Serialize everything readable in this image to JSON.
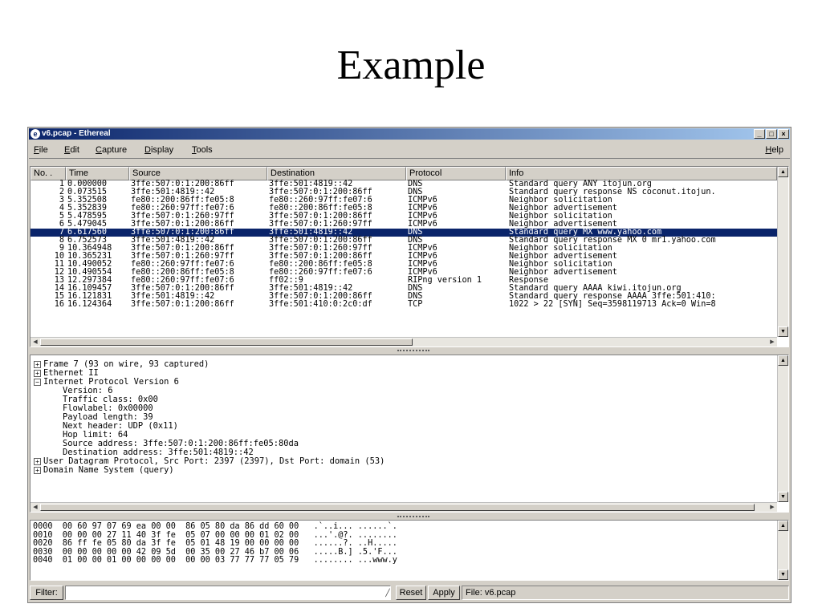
{
  "slide": {
    "title": "Example"
  },
  "window": {
    "title": "v6.pcap - Ethereal",
    "buttons": {
      "minimize": "_",
      "maximize": "□",
      "close": "×"
    }
  },
  "menu": {
    "file": "File",
    "edit": "Edit",
    "capture": "Capture",
    "display": "Display",
    "tools": "Tools",
    "help": "Help"
  },
  "packet_list": {
    "columns": [
      "No. .",
      "Time",
      "Source",
      "Destination",
      "Protocol",
      "Info"
    ],
    "selected_index": 6,
    "rows": [
      [
        "1",
        "0.000000",
        "3ffe:507:0:1:200:86ff",
        "3ffe:501:4819::42",
        "DNS",
        "Standard query ANY itojun.org"
      ],
      [
        "2",
        "0.073515",
        "3ffe:501:4819::42",
        "3ffe:507:0:1:200:86ff",
        "DNS",
        "Standard query response NS coconut.itojun."
      ],
      [
        "3",
        "5.352508",
        "fe80::200:86ff:fe05:8",
        "fe80::260:97ff:fe07:6",
        "ICMPv6",
        "Neighbor solicitation"
      ],
      [
        "4",
        "5.352839",
        "fe80::260:97ff:fe07:6",
        "fe80::200:86ff:fe05:8",
        "ICMPv6",
        "Neighbor advertisement"
      ],
      [
        "5",
        "5.478595",
        "3ffe:507:0:1:260:97ff",
        "3ffe:507:0:1:200:86ff",
        "ICMPv6",
        "Neighbor solicitation"
      ],
      [
        "6",
        "5.479045",
        "3ffe:507:0:1:200:86ff",
        "3ffe:507:0:1:260:97ff",
        "ICMPv6",
        "Neighbor advertisement"
      ],
      [
        "7",
        "6.617560",
        "3ffe:507:0:1:200:86ff",
        "3ffe:501:4819::42",
        "DNS",
        "Standard query MX www.yahoo.com"
      ],
      [
        "8",
        "6.752573",
        "3ffe:501:4819::42",
        "3ffe:507:0:1:200:86ff",
        "DNS",
        "Standard query response MX 0 mr1.yahoo.com"
      ],
      [
        "9",
        "10.364948",
        "3ffe:507:0:1:200:86ff",
        "3ffe:507:0:1:260:97ff",
        "ICMPv6",
        "Neighbor solicitation"
      ],
      [
        "10",
        "10.365231",
        "3ffe:507:0:1:260:97ff",
        "3ffe:507:0:1:200:86ff",
        "ICMPv6",
        "Neighbor advertisement"
      ],
      [
        "11",
        "10.490052",
        "fe80::260:97ff:fe07:6",
        "fe80::200:86ff:fe05:8",
        "ICMPv6",
        "Neighbor solicitation"
      ],
      [
        "12",
        "10.490554",
        "fe80::200:86ff:fe05:8",
        "fe80::260:97ff:fe07:6",
        "ICMPv6",
        "Neighbor advertisement"
      ],
      [
        "13",
        "12.297384",
        "fe80::260:97ff:fe07:6",
        "ff02::9",
        "RIPng version 1",
        "Response"
      ],
      [
        "14",
        "16.109457",
        "3ffe:507:0:1:200:86ff",
        "3ffe:501:4819::42",
        "DNS",
        "Standard query AAAA kiwi.itojun.org"
      ],
      [
        "15",
        "16.121831",
        "3ffe:501:4819::42",
        "3ffe:507:0:1:200:86ff",
        "DNS",
        "Standard query response AAAA 3ffe:501:410:"
      ],
      [
        "16",
        "16.124364",
        "3ffe:507:0:1:200:86ff",
        "3ffe:501:410:0:2c0:df",
        "TCP",
        "1022 > 22 [SYN] Seq=3598119713 Ack=0 Win=8"
      ]
    ]
  },
  "details": {
    "lines": [
      {
        "box": "+",
        "text": "Frame 7 (93 on wire, 93 captured)",
        "indent": false
      },
      {
        "box": "+",
        "text": "Ethernet II",
        "indent": false
      },
      {
        "box": "−",
        "text": "Internet Protocol Version 6",
        "indent": false
      },
      {
        "box": "",
        "text": "Version: 6",
        "indent": true
      },
      {
        "box": "",
        "text": "Traffic class: 0x00",
        "indent": true
      },
      {
        "box": "",
        "text": "Flowlabel: 0x00000",
        "indent": true
      },
      {
        "box": "",
        "text": "Payload length: 39",
        "indent": true
      },
      {
        "box": "",
        "text": "Next header: UDP (0x11)",
        "indent": true
      },
      {
        "box": "",
        "text": "Hop limit: 64",
        "indent": true
      },
      {
        "box": "",
        "text": "Source address: 3ffe:507:0:1:200:86ff:fe05:80da",
        "indent": true
      },
      {
        "box": "",
        "text": "Destination address: 3ffe:501:4819::42",
        "indent": true
      },
      {
        "box": "+",
        "text": "User Datagram Protocol, Src Port: 2397 (2397), Dst Port: domain (53)",
        "indent": false
      },
      {
        "box": "+",
        "text": "Domain Name System (query)",
        "indent": false
      }
    ]
  },
  "bytes": {
    "lines": [
      "0000  00 60 97 07 69 ea 00 00  86 05 80 da 86 dd 60 00   .`..i... ......`.",
      "0010  00 00 00 27 11 40 3f fe  05 07 00 00 00 01 02 00   ...'.@?. ........",
      "0020  86 ff fe 05 80 da 3f fe  05 01 48 19 00 00 00 00   ......?. ..H.....",
      "0030  00 00 00 00 00 42 09 5d  00 35 00 27 46 b7 00 06   .....B.] .5.'F...",
      "0040  01 00 00 01 00 00 00 00  00 00 03 77 77 77 05 79   ........ ...www.y"
    ]
  },
  "filterbar": {
    "filter_label": "Filter:",
    "filter_value": "",
    "reset_label": "Reset",
    "apply_label": "Apply",
    "status": "File: v6.pcap"
  },
  "colors": {
    "titlebar": "#0a246a",
    "selection": "#0a246a",
    "chrome": "#d4d0c8"
  }
}
